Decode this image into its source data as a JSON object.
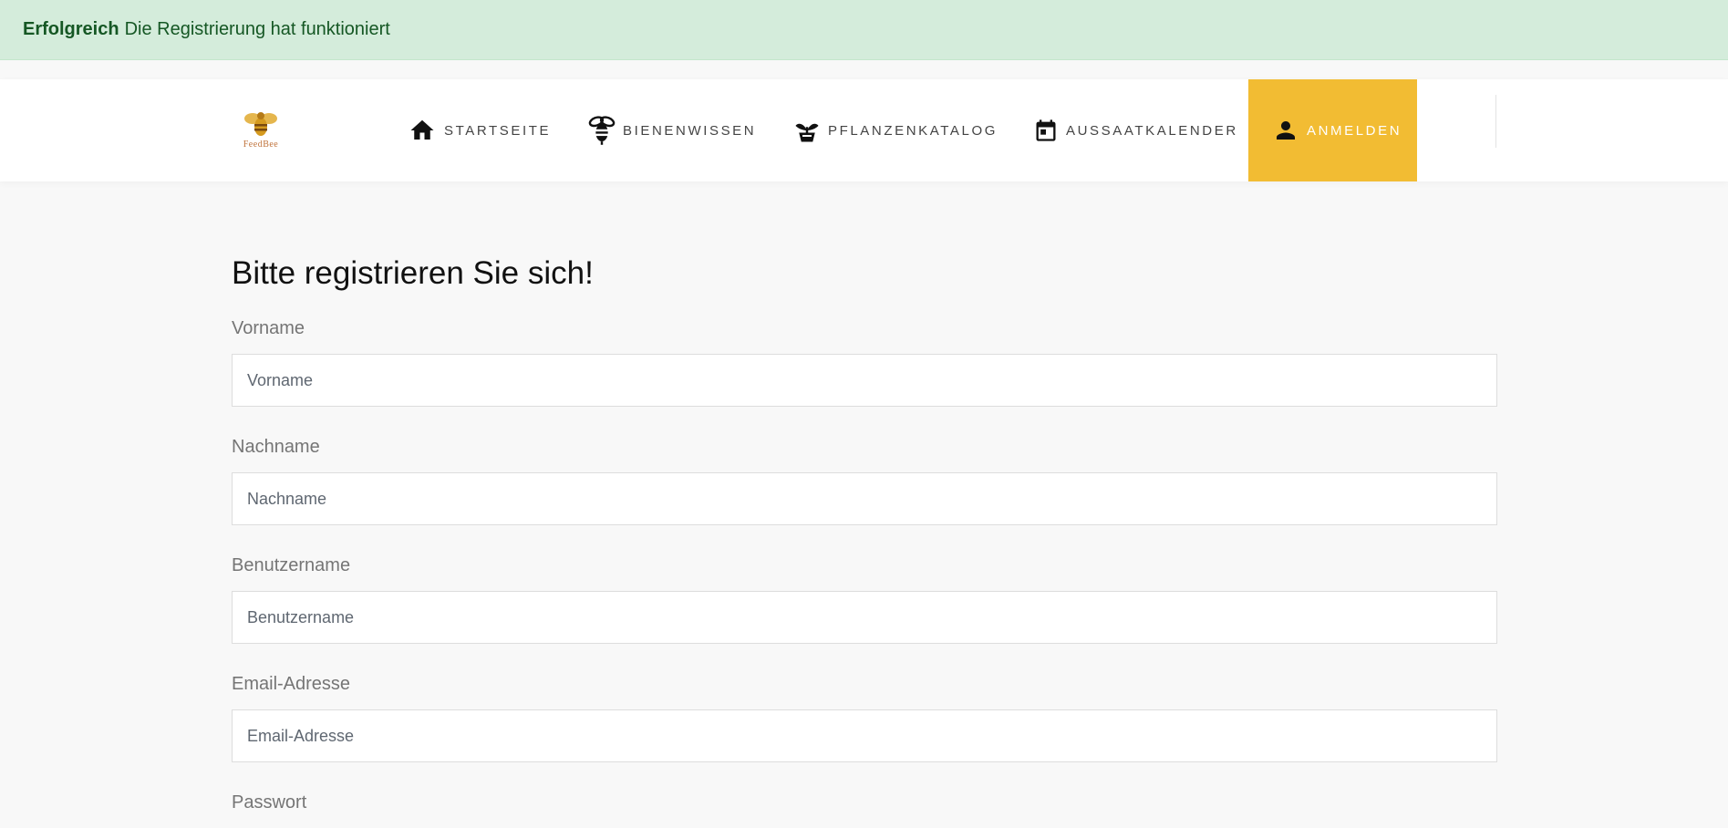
{
  "alert": {
    "title": "Erfolgreich",
    "message": "Die Registrierung hat funktioniert"
  },
  "logo": {
    "text": "FeedBee"
  },
  "nav": {
    "home": "STARTSEITE",
    "bees": "BIENENWISSEN",
    "plants": "PFLANZENKATALOG",
    "calendar": "AUSSAATKALENDER",
    "login": "ANMELDEN"
  },
  "form": {
    "title": "Bitte registrieren Sie sich!",
    "fields": [
      {
        "label": "Vorname",
        "placeholder": "Vorname",
        "value": ""
      },
      {
        "label": "Nachname",
        "placeholder": "Nachname",
        "value": ""
      },
      {
        "label": "Benutzername",
        "placeholder": "Benutzername",
        "value": ""
      },
      {
        "label": "Email-Adresse",
        "placeholder": "Email-Adresse",
        "value": ""
      },
      {
        "label": "Passwort"
      }
    ]
  },
  "colors": {
    "alert_bg": "#d4ecdb",
    "alert_text": "#155724",
    "accent": "#f2bc33",
    "background": "#f8f8f8"
  },
  "icons": [
    "home-icon",
    "bee-icon",
    "plant-icon",
    "calendar-icon",
    "person-icon"
  ]
}
